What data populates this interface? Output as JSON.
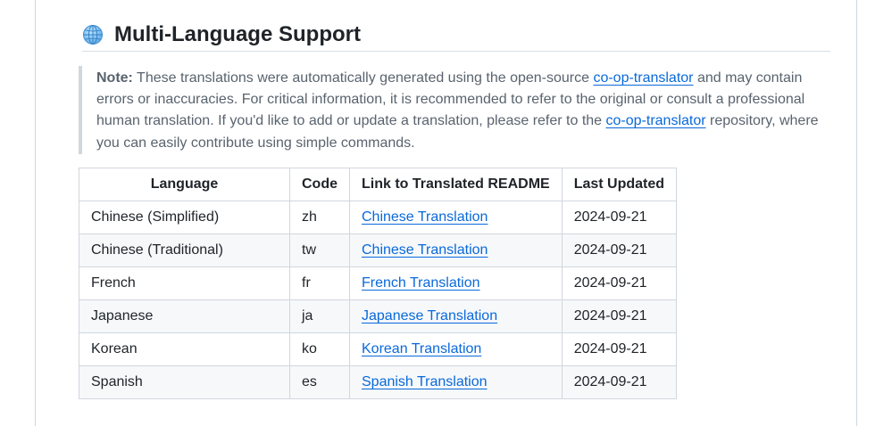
{
  "heading": {
    "title": "Multi-Language Support",
    "icon": "globe-icon"
  },
  "note": {
    "label": "Note:",
    "text_1": " These translations were automatically generated using the open-source ",
    "link_1": "co-op-translator",
    "text_2": " and may contain errors or inaccuracies. For critical information, it is recommended to refer to the original or consult a professional human translation. If you'd like to add or update a translation, please refer to the ",
    "link_2": "co-op-translator",
    "text_3": " repository, where you can easily contribute using simple commands."
  },
  "table": {
    "headers": [
      "Language",
      "Code",
      "Link to Translated README",
      "Last Updated"
    ],
    "rows": [
      {
        "language": "Chinese (Simplified)",
        "code": "zh",
        "link": "Chinese Translation",
        "updated": "2024-09-21"
      },
      {
        "language": "Chinese (Traditional)",
        "code": "tw",
        "link": "Chinese Translation",
        "updated": "2024-09-21"
      },
      {
        "language": "French",
        "code": "fr",
        "link": "French Translation",
        "updated": "2024-09-21"
      },
      {
        "language": "Japanese",
        "code": "ja",
        "link": "Japanese Translation",
        "updated": "2024-09-21"
      },
      {
        "language": "Korean",
        "code": "ko",
        "link": "Korean Translation",
        "updated": "2024-09-21"
      },
      {
        "language": "Spanish",
        "code": "es",
        "link": "Spanish Translation",
        "updated": "2024-09-21"
      }
    ]
  },
  "colors": {
    "link": "#0969da",
    "text": "#1f2328",
    "muted": "#59636e",
    "border": "#d0d7de",
    "stripe": "#f6f8fa"
  }
}
